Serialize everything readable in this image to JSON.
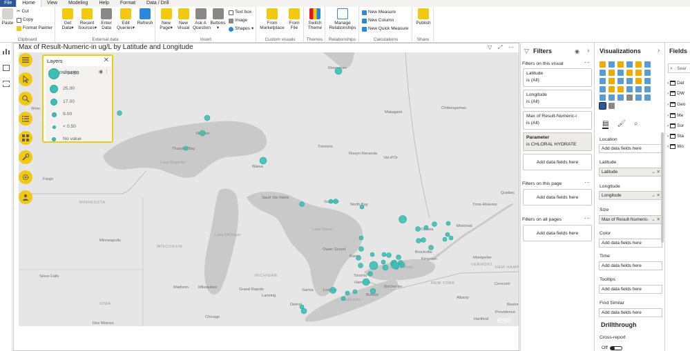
{
  "tabs": [
    "File",
    "Home",
    "View",
    "Modeling",
    "Help",
    "Format",
    "Data / Drill"
  ],
  "active_tab": "Home",
  "ribbon": {
    "clipboard": {
      "paste": "Paste",
      "cut": "Cut",
      "copy": "Copy",
      "format_painter": "Format Painter",
      "label": "Clipboard"
    },
    "external_data": {
      "buttons": [
        {
          "line1": "Get",
          "line2": "Data",
          "dropdown": true
        },
        {
          "line1": "Recent",
          "line2": "Sources",
          "dropdown": true
        },
        {
          "line1": "Enter",
          "line2": "Data",
          "dropdown": false
        },
        {
          "line1": "Edit",
          "line2": "Queries",
          "dropdown": true
        },
        {
          "line1": "Refresh",
          "line2": "",
          "dropdown": false
        }
      ],
      "label": "External data"
    },
    "insert": {
      "buttons": [
        {
          "line1": "New",
          "line2": "Page",
          "dropdown": true
        },
        {
          "line1": "New",
          "line2": "Visual",
          "dropdown": false
        },
        {
          "line1": "Ask A",
          "line2": "Question",
          "dropdown": false
        },
        {
          "line1": "Buttons",
          "line2": "",
          "dropdown": true
        }
      ],
      "small": [
        "Text box",
        "Image",
        "Shapes"
      ],
      "label": "Insert"
    },
    "custom_visuals": {
      "buttons": [
        {
          "line1": "From",
          "line2": "Marketplace"
        },
        {
          "line1": "From",
          "line2": "File"
        }
      ],
      "label": "Custom visuals"
    },
    "themes": {
      "button": {
        "line1": "Switch",
        "line2": "Theme"
      },
      "label": "Themes"
    },
    "relationships": {
      "button": {
        "line1": "Manage",
        "line2": "Relationships"
      },
      "label": "Relationships"
    },
    "calculations": {
      "items": [
        "New Measure",
        "New Column",
        "New Quick Measure"
      ],
      "label": "Calculations"
    },
    "share": {
      "button": "Publish",
      "label": "Share"
    }
  },
  "visual": {
    "title": "Max of Result-Numeric-in ug/L by Latitude and Longitude",
    "attribution": "esri"
  },
  "map_labels": [
    {
      "text": "Moosonee"
    },
    {
      "text": "Matagami"
    },
    {
      "text": "Chibougamau"
    },
    {
      "text": "Winn"
    },
    {
      "text": "Nipigon"
    },
    {
      "text": "Thunder Bay"
    },
    {
      "text": "Timmins"
    },
    {
      "text": "Rouyn-Noranda"
    },
    {
      "text": "Val-d'Or"
    },
    {
      "text": "Wawa"
    },
    {
      "text": "Lake Superior"
    },
    {
      "text": "Fargo"
    },
    {
      "text": "MINNESOTA"
    },
    {
      "text": "Sault Ste Marie"
    },
    {
      "text": "Sudbury"
    },
    {
      "text": "North Bay"
    },
    {
      "text": "Quebec"
    },
    {
      "text": "Trois-Rivieres"
    },
    {
      "text": "Minneapolis"
    },
    {
      "text": "WISCONSIN"
    },
    {
      "text": "Ottawa"
    },
    {
      "text": "Montreal"
    },
    {
      "text": "Owen Sound"
    },
    {
      "text": "Barrie"
    },
    {
      "text": "Brockville"
    },
    {
      "text": "Kingston"
    },
    {
      "text": "Montpelier"
    },
    {
      "text": "VERMONT"
    },
    {
      "text": "NEW HAMPSHIRE"
    },
    {
      "text": "Sioux Falls"
    },
    {
      "text": "MICHIGAN"
    },
    {
      "text": "Toronto"
    },
    {
      "text": "Lake Ontario"
    },
    {
      "text": "Madison"
    },
    {
      "text": "Milwaukee"
    },
    {
      "text": "Grand Rapids"
    },
    {
      "text": "Hamilton"
    },
    {
      "text": "Rochester"
    },
    {
      "text": "NEW YORK"
    },
    {
      "text": "Concord"
    },
    {
      "text": "Lansing"
    },
    {
      "text": "Sarnia"
    },
    {
      "text": "London"
    },
    {
      "text": "Buffalo"
    },
    {
      "text": "Albany"
    },
    {
      "text": "IOWA"
    },
    {
      "text": "Detroit"
    },
    {
      "text": "Boston"
    },
    {
      "text": "Chicago"
    },
    {
      "text": "Des Moines"
    },
    {
      "text": "Hartford"
    },
    {
      "text": "Providence"
    },
    {
      "text": "Lake Michigan"
    },
    {
      "text": "Lake Huron"
    },
    {
      "text": "Lake Erie"
    }
  ],
  "layers_panel": {
    "title": "Layers",
    "layer_name": "Coordinates",
    "legend": [
      {
        "label": "> 34.50"
      },
      {
        "label": "25.00"
      },
      {
        "label": "17.00"
      },
      {
        "label": "9.00"
      },
      {
        "label": "< 0.50"
      },
      {
        "label": "No value"
      }
    ]
  },
  "filters": {
    "title": "Filters",
    "on_visual_label": "Filters on this visual",
    "visual_filters": [
      {
        "field": "Latitude",
        "value": "is (All)"
      },
      {
        "field": "Longitude",
        "value": "is (All)"
      },
      {
        "field": "Max of Result-Numeric-i",
        "value": "is (All)"
      }
    ],
    "parameter": {
      "field": "Parameter",
      "value": "is CHLORAL HYDRATE"
    },
    "add_fields": "Add data fields here",
    "on_page_label": "Filters on this page",
    "on_all_pages_label": "Filters on all pages"
  },
  "visualizations": {
    "title": "Visualizations",
    "wells": [
      {
        "label": "Location",
        "value": "Add data fields here",
        "filled": false
      },
      {
        "label": "Latitude",
        "value": "Latitude",
        "filled": true
      },
      {
        "label": "Longitude",
        "value": "Longitude",
        "filled": true
      },
      {
        "label": "Size",
        "value": "Max of Result-Numeric-",
        "filled": true
      },
      {
        "label": "Color",
        "value": "Add data fields here",
        "filled": false
      },
      {
        "label": "Time",
        "value": "Add data fields here",
        "filled": false
      },
      {
        "label": "Tooltips",
        "value": "Add data fields here",
        "filled": false
      },
      {
        "label": "Find Similar",
        "value": "Add data fields here",
        "filled": false
      }
    ],
    "drillthrough": "Drillthrough",
    "cross_report": "Cross-report",
    "toggle_state": "Off"
  },
  "fields_pane": {
    "title": "Fields",
    "search_placeholder": "Sear",
    "items": [
      "Dat",
      "DW",
      "Geo",
      "Me",
      "Sor",
      "Sta",
      "Wo"
    ]
  },
  "theme": {
    "accent": "#f2c811",
    "bubble": "#3cbfb4",
    "map_land": "#e6e6e6",
    "map_water": "#c9c9c9",
    "file_tab": "#2b579a"
  }
}
